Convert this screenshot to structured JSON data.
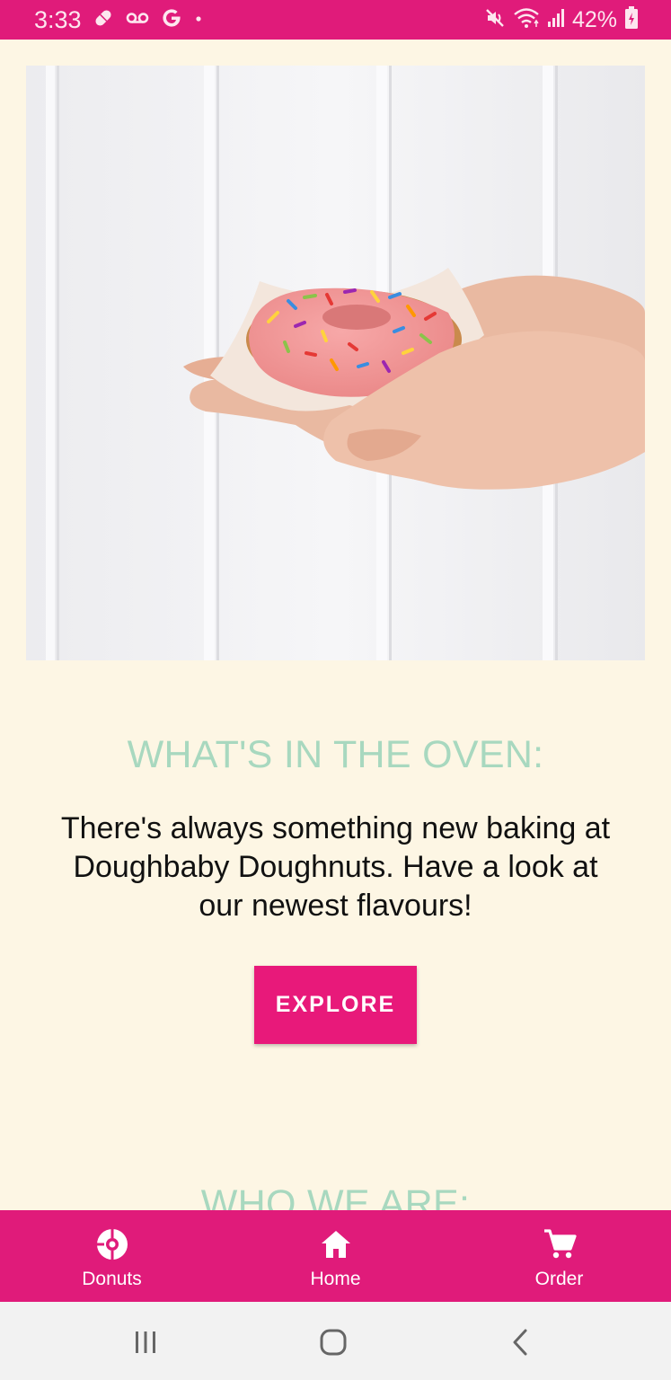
{
  "status_bar": {
    "time": "3:33",
    "battery_percent": "42%",
    "left_icons": [
      "medication-icon",
      "voicemail-icon",
      "google-icon",
      "dot-icon"
    ],
    "right_icons": [
      "mute-icon",
      "wifi-icon",
      "signal-icon",
      "battery-charging-icon"
    ]
  },
  "hero": {
    "image": "hand-holding-pink-sprinkle-donut"
  },
  "oven_section": {
    "title": "WHAT'S IN THE OVEN:",
    "description": "There's always something new baking at Doughbaby Doughnuts. Have a look at our newest flavours!",
    "button_label": "EXPLORE"
  },
  "who_section": {
    "title": "WHO WE ARE:"
  },
  "bottom_nav": {
    "items": [
      {
        "label": "Donuts",
        "icon": "donut-icon"
      },
      {
        "label": "Home",
        "icon": "home-icon"
      },
      {
        "label": "Order",
        "icon": "cart-icon"
      }
    ]
  },
  "system_nav": {
    "buttons": [
      "recents-icon",
      "home-circle-icon",
      "back-icon"
    ]
  },
  "colors": {
    "primary": "#E01B7A",
    "button": "#E8197A",
    "background": "#FDF6E4",
    "section_title": "#A8D8BF"
  }
}
